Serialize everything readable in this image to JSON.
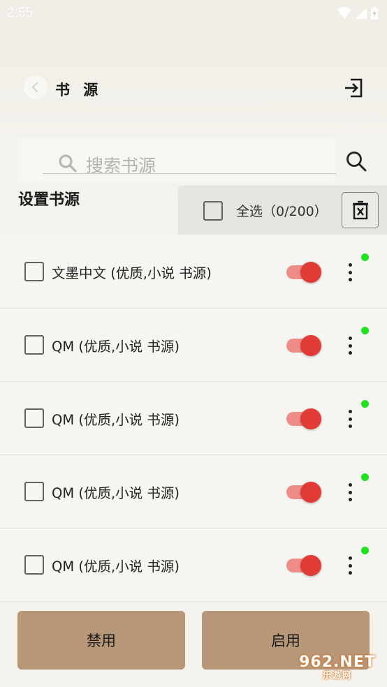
{
  "status_bar": {
    "time": "2:55"
  },
  "toolbar": {
    "title": "书 源"
  },
  "search": {
    "placeholder": "搜索书源"
  },
  "section": {
    "title": "设置书源"
  },
  "select_bar": {
    "label": "全选（0/200）"
  },
  "sources": [
    {
      "label": "文墨中文 (优质,小说 书源)",
      "enabled": true,
      "checked": false
    },
    {
      "label": "QM (优质,小说 书源)",
      "enabled": true,
      "checked": false
    },
    {
      "label": "QM (优质,小说 书源)",
      "enabled": true,
      "checked": false
    },
    {
      "label": "QM (优质,小说 书源)",
      "enabled": true,
      "checked": false
    },
    {
      "label": "QM (优质,小说 书源)",
      "enabled": true,
      "checked": false
    }
  ],
  "actions": {
    "disable_label": "禁用",
    "enable_label": "启用"
  },
  "watermark": {
    "top": "962.NET",
    "bottom": "乐游网"
  },
  "colors": {
    "accent_button": "#b79778",
    "toggle_on_thumb": "#e23b35",
    "toggle_on_track": "#ee8d88",
    "status_dot": "#20e020",
    "background": "#f5f3ee"
  }
}
